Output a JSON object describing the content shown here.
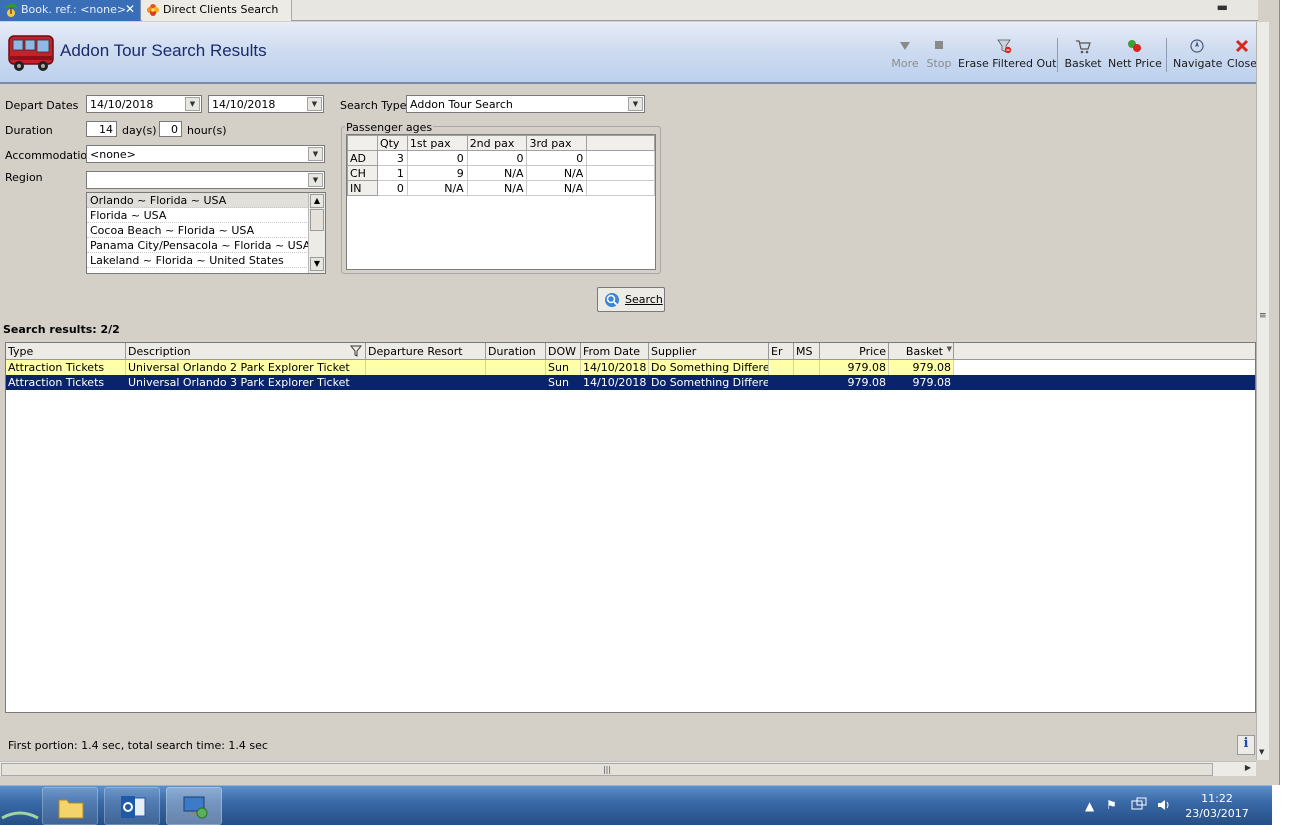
{
  "tabs": [
    {
      "label": "Book. ref.: <none>",
      "active": true
    },
    {
      "label": "Direct Clients Search",
      "active": false
    }
  ],
  "header": {
    "title": "Addon Tour Search Results"
  },
  "toolbar": {
    "more": "More",
    "stop": "Stop",
    "erase": "Erase Filtered Out",
    "basket": "Basket",
    "nett_price": "Nett Price",
    "navigate": "Navigate",
    "close": "Close"
  },
  "form": {
    "depart_label": "Depart Dates",
    "depart_from": "14/10/2018",
    "depart_to": "14/10/2018",
    "duration_label": "Duration",
    "duration_days": "14",
    "days_unit": "day(s)",
    "duration_hours": "0",
    "hours_unit": "hour(s)",
    "accommodation_label": "Accommodation",
    "accommodation_value": "<none>",
    "region_label": "Region",
    "region_value": "",
    "regions": [
      "Orlando ~ Florida ~ USA",
      "Florida ~ USA",
      "Cocoa Beach ~ Florida ~ USA",
      "Panama City/Pensacola ~  Florida  ~ USA",
      "Lakeland ~ Florida ~ United States"
    ],
    "search_type_label": "Search Type",
    "search_type_value": "Addon Tour Search"
  },
  "passengers": {
    "title": "Passenger ages",
    "headers": [
      "",
      "Qty",
      "1st pax",
      "2nd pax",
      "3rd pax",
      ""
    ],
    "rows": [
      {
        "type": "AD",
        "qty": "3",
        "p1": "0",
        "p2": "0",
        "p3": "0"
      },
      {
        "type": "CH",
        "qty": "1",
        "p1": "9",
        "p2": "N/A",
        "p3": "N/A"
      },
      {
        "type": "IN",
        "qty": "0",
        "p1": "N/A",
        "p2": "N/A",
        "p3": "N/A"
      }
    ]
  },
  "search_button": "Search",
  "results": {
    "label": "Search results: 2/2",
    "columns": [
      "Type",
      "Description",
      "Departure Resort",
      "Duration",
      "DOW",
      "From Date",
      "Supplier",
      "Er",
      "MS",
      "Price",
      "Basket"
    ],
    "rows": [
      {
        "type": "Attraction Tickets",
        "description": "Universal Orlando 2 Park Explorer Ticket",
        "resort": "",
        "duration": "",
        "dow": "Sun",
        "from_date": "14/10/2018",
        "supplier": "Do Something Different",
        "er": "",
        "ms": "",
        "price": "979.08",
        "basket": "979.08",
        "selected": false
      },
      {
        "type": "Attraction Tickets",
        "description": "Universal Orlando 3 Park Explorer Ticket",
        "resort": "",
        "duration": "",
        "dow": "Sun",
        "from_date": "14/10/2018",
        "supplier": "Do Something Different",
        "er": "",
        "ms": "",
        "price": "979.08",
        "basket": "979.08",
        "selected": true
      }
    ]
  },
  "status": "First portion: 1.4 sec, total search time: 1.4 sec",
  "info_button": "i",
  "taskbar": {
    "time": "11:22",
    "date": "23/03/2017"
  },
  "colors": {
    "header_title": "#1a2a6e",
    "selected_row": "#0a246a",
    "highlight_row": "#ffffa8",
    "taskbar": "#3a6aa8"
  }
}
